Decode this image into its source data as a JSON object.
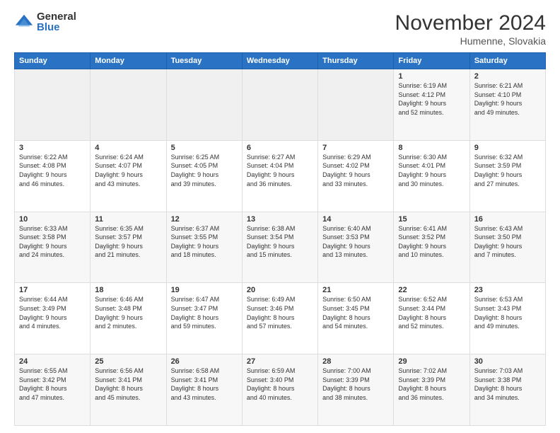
{
  "logo": {
    "general": "General",
    "blue": "Blue"
  },
  "title": "November 2024",
  "location": "Humenne, Slovakia",
  "days_header": [
    "Sunday",
    "Monday",
    "Tuesday",
    "Wednesday",
    "Thursday",
    "Friday",
    "Saturday"
  ],
  "weeks": [
    [
      {
        "day": "",
        "info": ""
      },
      {
        "day": "",
        "info": ""
      },
      {
        "day": "",
        "info": ""
      },
      {
        "day": "",
        "info": ""
      },
      {
        "day": "",
        "info": ""
      },
      {
        "day": "1",
        "info": "Sunrise: 6:19 AM\nSunset: 4:12 PM\nDaylight: 9 hours\nand 52 minutes."
      },
      {
        "day": "2",
        "info": "Sunrise: 6:21 AM\nSunset: 4:10 PM\nDaylight: 9 hours\nand 49 minutes."
      }
    ],
    [
      {
        "day": "3",
        "info": "Sunrise: 6:22 AM\nSunset: 4:08 PM\nDaylight: 9 hours\nand 46 minutes."
      },
      {
        "day": "4",
        "info": "Sunrise: 6:24 AM\nSunset: 4:07 PM\nDaylight: 9 hours\nand 43 minutes."
      },
      {
        "day": "5",
        "info": "Sunrise: 6:25 AM\nSunset: 4:05 PM\nDaylight: 9 hours\nand 39 minutes."
      },
      {
        "day": "6",
        "info": "Sunrise: 6:27 AM\nSunset: 4:04 PM\nDaylight: 9 hours\nand 36 minutes."
      },
      {
        "day": "7",
        "info": "Sunrise: 6:29 AM\nSunset: 4:02 PM\nDaylight: 9 hours\nand 33 minutes."
      },
      {
        "day": "8",
        "info": "Sunrise: 6:30 AM\nSunset: 4:01 PM\nDaylight: 9 hours\nand 30 minutes."
      },
      {
        "day": "9",
        "info": "Sunrise: 6:32 AM\nSunset: 3:59 PM\nDaylight: 9 hours\nand 27 minutes."
      }
    ],
    [
      {
        "day": "10",
        "info": "Sunrise: 6:33 AM\nSunset: 3:58 PM\nDaylight: 9 hours\nand 24 minutes."
      },
      {
        "day": "11",
        "info": "Sunrise: 6:35 AM\nSunset: 3:57 PM\nDaylight: 9 hours\nand 21 minutes."
      },
      {
        "day": "12",
        "info": "Sunrise: 6:37 AM\nSunset: 3:55 PM\nDaylight: 9 hours\nand 18 minutes."
      },
      {
        "day": "13",
        "info": "Sunrise: 6:38 AM\nSunset: 3:54 PM\nDaylight: 9 hours\nand 15 minutes."
      },
      {
        "day": "14",
        "info": "Sunrise: 6:40 AM\nSunset: 3:53 PM\nDaylight: 9 hours\nand 13 minutes."
      },
      {
        "day": "15",
        "info": "Sunrise: 6:41 AM\nSunset: 3:52 PM\nDaylight: 9 hours\nand 10 minutes."
      },
      {
        "day": "16",
        "info": "Sunrise: 6:43 AM\nSunset: 3:50 PM\nDaylight: 9 hours\nand 7 minutes."
      }
    ],
    [
      {
        "day": "17",
        "info": "Sunrise: 6:44 AM\nSunset: 3:49 PM\nDaylight: 9 hours\nand 4 minutes."
      },
      {
        "day": "18",
        "info": "Sunrise: 6:46 AM\nSunset: 3:48 PM\nDaylight: 9 hours\nand 2 minutes."
      },
      {
        "day": "19",
        "info": "Sunrise: 6:47 AM\nSunset: 3:47 PM\nDaylight: 8 hours\nand 59 minutes."
      },
      {
        "day": "20",
        "info": "Sunrise: 6:49 AM\nSunset: 3:46 PM\nDaylight: 8 hours\nand 57 minutes."
      },
      {
        "day": "21",
        "info": "Sunrise: 6:50 AM\nSunset: 3:45 PM\nDaylight: 8 hours\nand 54 minutes."
      },
      {
        "day": "22",
        "info": "Sunrise: 6:52 AM\nSunset: 3:44 PM\nDaylight: 8 hours\nand 52 minutes."
      },
      {
        "day": "23",
        "info": "Sunrise: 6:53 AM\nSunset: 3:43 PM\nDaylight: 8 hours\nand 49 minutes."
      }
    ],
    [
      {
        "day": "24",
        "info": "Sunrise: 6:55 AM\nSunset: 3:42 PM\nDaylight: 8 hours\nand 47 minutes."
      },
      {
        "day": "25",
        "info": "Sunrise: 6:56 AM\nSunset: 3:41 PM\nDaylight: 8 hours\nand 45 minutes."
      },
      {
        "day": "26",
        "info": "Sunrise: 6:58 AM\nSunset: 3:41 PM\nDaylight: 8 hours\nand 43 minutes."
      },
      {
        "day": "27",
        "info": "Sunrise: 6:59 AM\nSunset: 3:40 PM\nDaylight: 8 hours\nand 40 minutes."
      },
      {
        "day": "28",
        "info": "Sunrise: 7:00 AM\nSunset: 3:39 PM\nDaylight: 8 hours\nand 38 minutes."
      },
      {
        "day": "29",
        "info": "Sunrise: 7:02 AM\nSunset: 3:39 PM\nDaylight: 8 hours\nand 36 minutes."
      },
      {
        "day": "30",
        "info": "Sunrise: 7:03 AM\nSunset: 3:38 PM\nDaylight: 8 hours\nand 34 minutes."
      }
    ]
  ]
}
